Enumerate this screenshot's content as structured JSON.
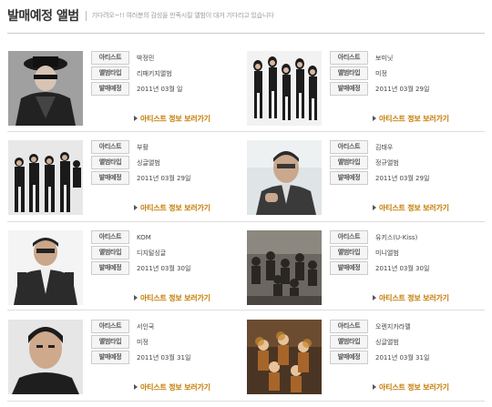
{
  "header": {
    "title": "발매예정 앨범",
    "subtitle": "기다려오~!! 여러분의 감성을 만족시킬 앨범이 대거 기다리고 있습니다"
  },
  "labels": {
    "artist": "아티스트",
    "type": "앨범타입",
    "date": "발매예정"
  },
  "link_label": "아티스트 정보 보러가기",
  "albums": [
    {
      "artist": "박정민",
      "type": "리패키지앨범",
      "date": "2011년 03월 일"
    },
    {
      "artist": "보미닛",
      "type": "미정",
      "date": "2011년 03월 29일"
    },
    {
      "artist": "부활",
      "type": "싱글앨범",
      "date": "2011년 03월 29일"
    },
    {
      "artist": "김태우",
      "type": "정규앨범",
      "date": "2011년 03월 29일"
    },
    {
      "artist": "KOM",
      "type": "디지털싱글",
      "date": "2011년 03월 30일"
    },
    {
      "artist": "유키스(U-Kiss)",
      "type": "미니앨범",
      "date": "2011년 03월 30일"
    },
    {
      "artist": "서인국",
      "type": "미정",
      "date": "2011년 03월 31일"
    },
    {
      "artist": "오렌지카라멜",
      "type": "싱글앨범",
      "date": "2011년 03월 31일"
    }
  ]
}
